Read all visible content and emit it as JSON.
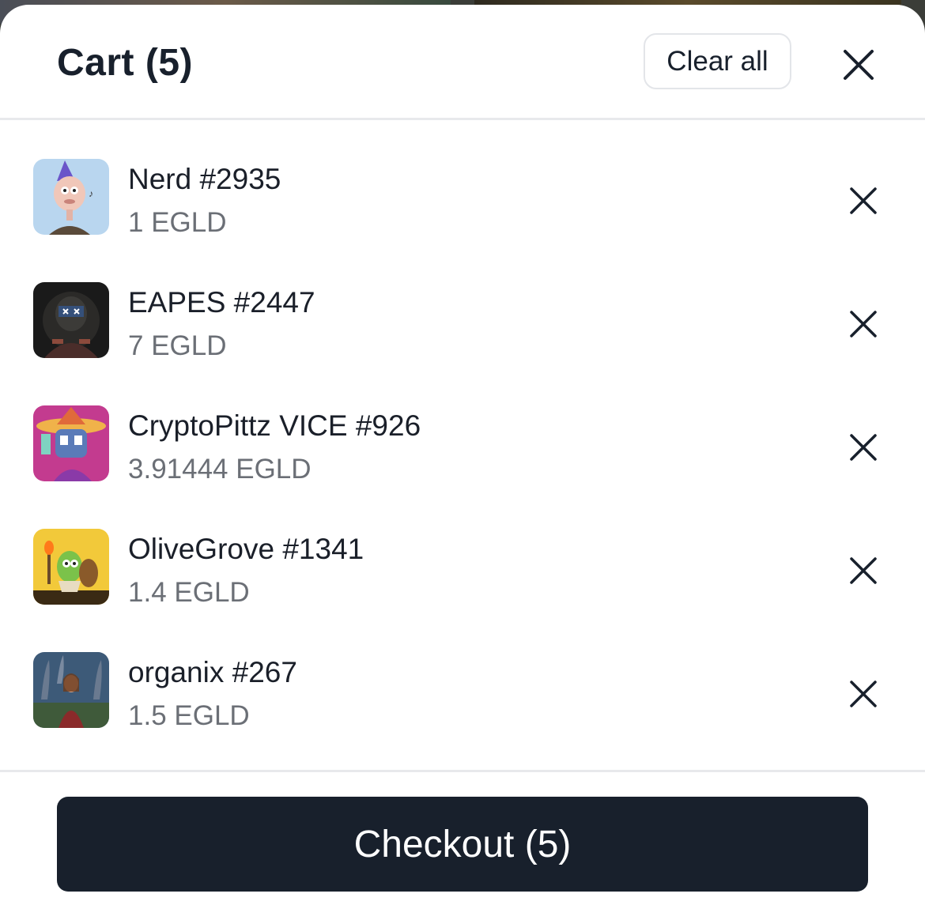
{
  "cart": {
    "title": "Cart (5)",
    "clear_label": "Clear all",
    "checkout_label": "Checkout (5)",
    "accent_color": "#18202c",
    "items": [
      {
        "name": "Nerd #2935",
        "price": "1 EGLD"
      },
      {
        "name": "EAPES #2447",
        "price": "7 EGLD"
      },
      {
        "name": "CryptoPittz VICE #926",
        "price": "3.91444 EGLD"
      },
      {
        "name": "OliveGrove #1341",
        "price": "1.4 EGLD"
      },
      {
        "name": "organix #267",
        "price": "1.5 EGLD"
      }
    ]
  }
}
